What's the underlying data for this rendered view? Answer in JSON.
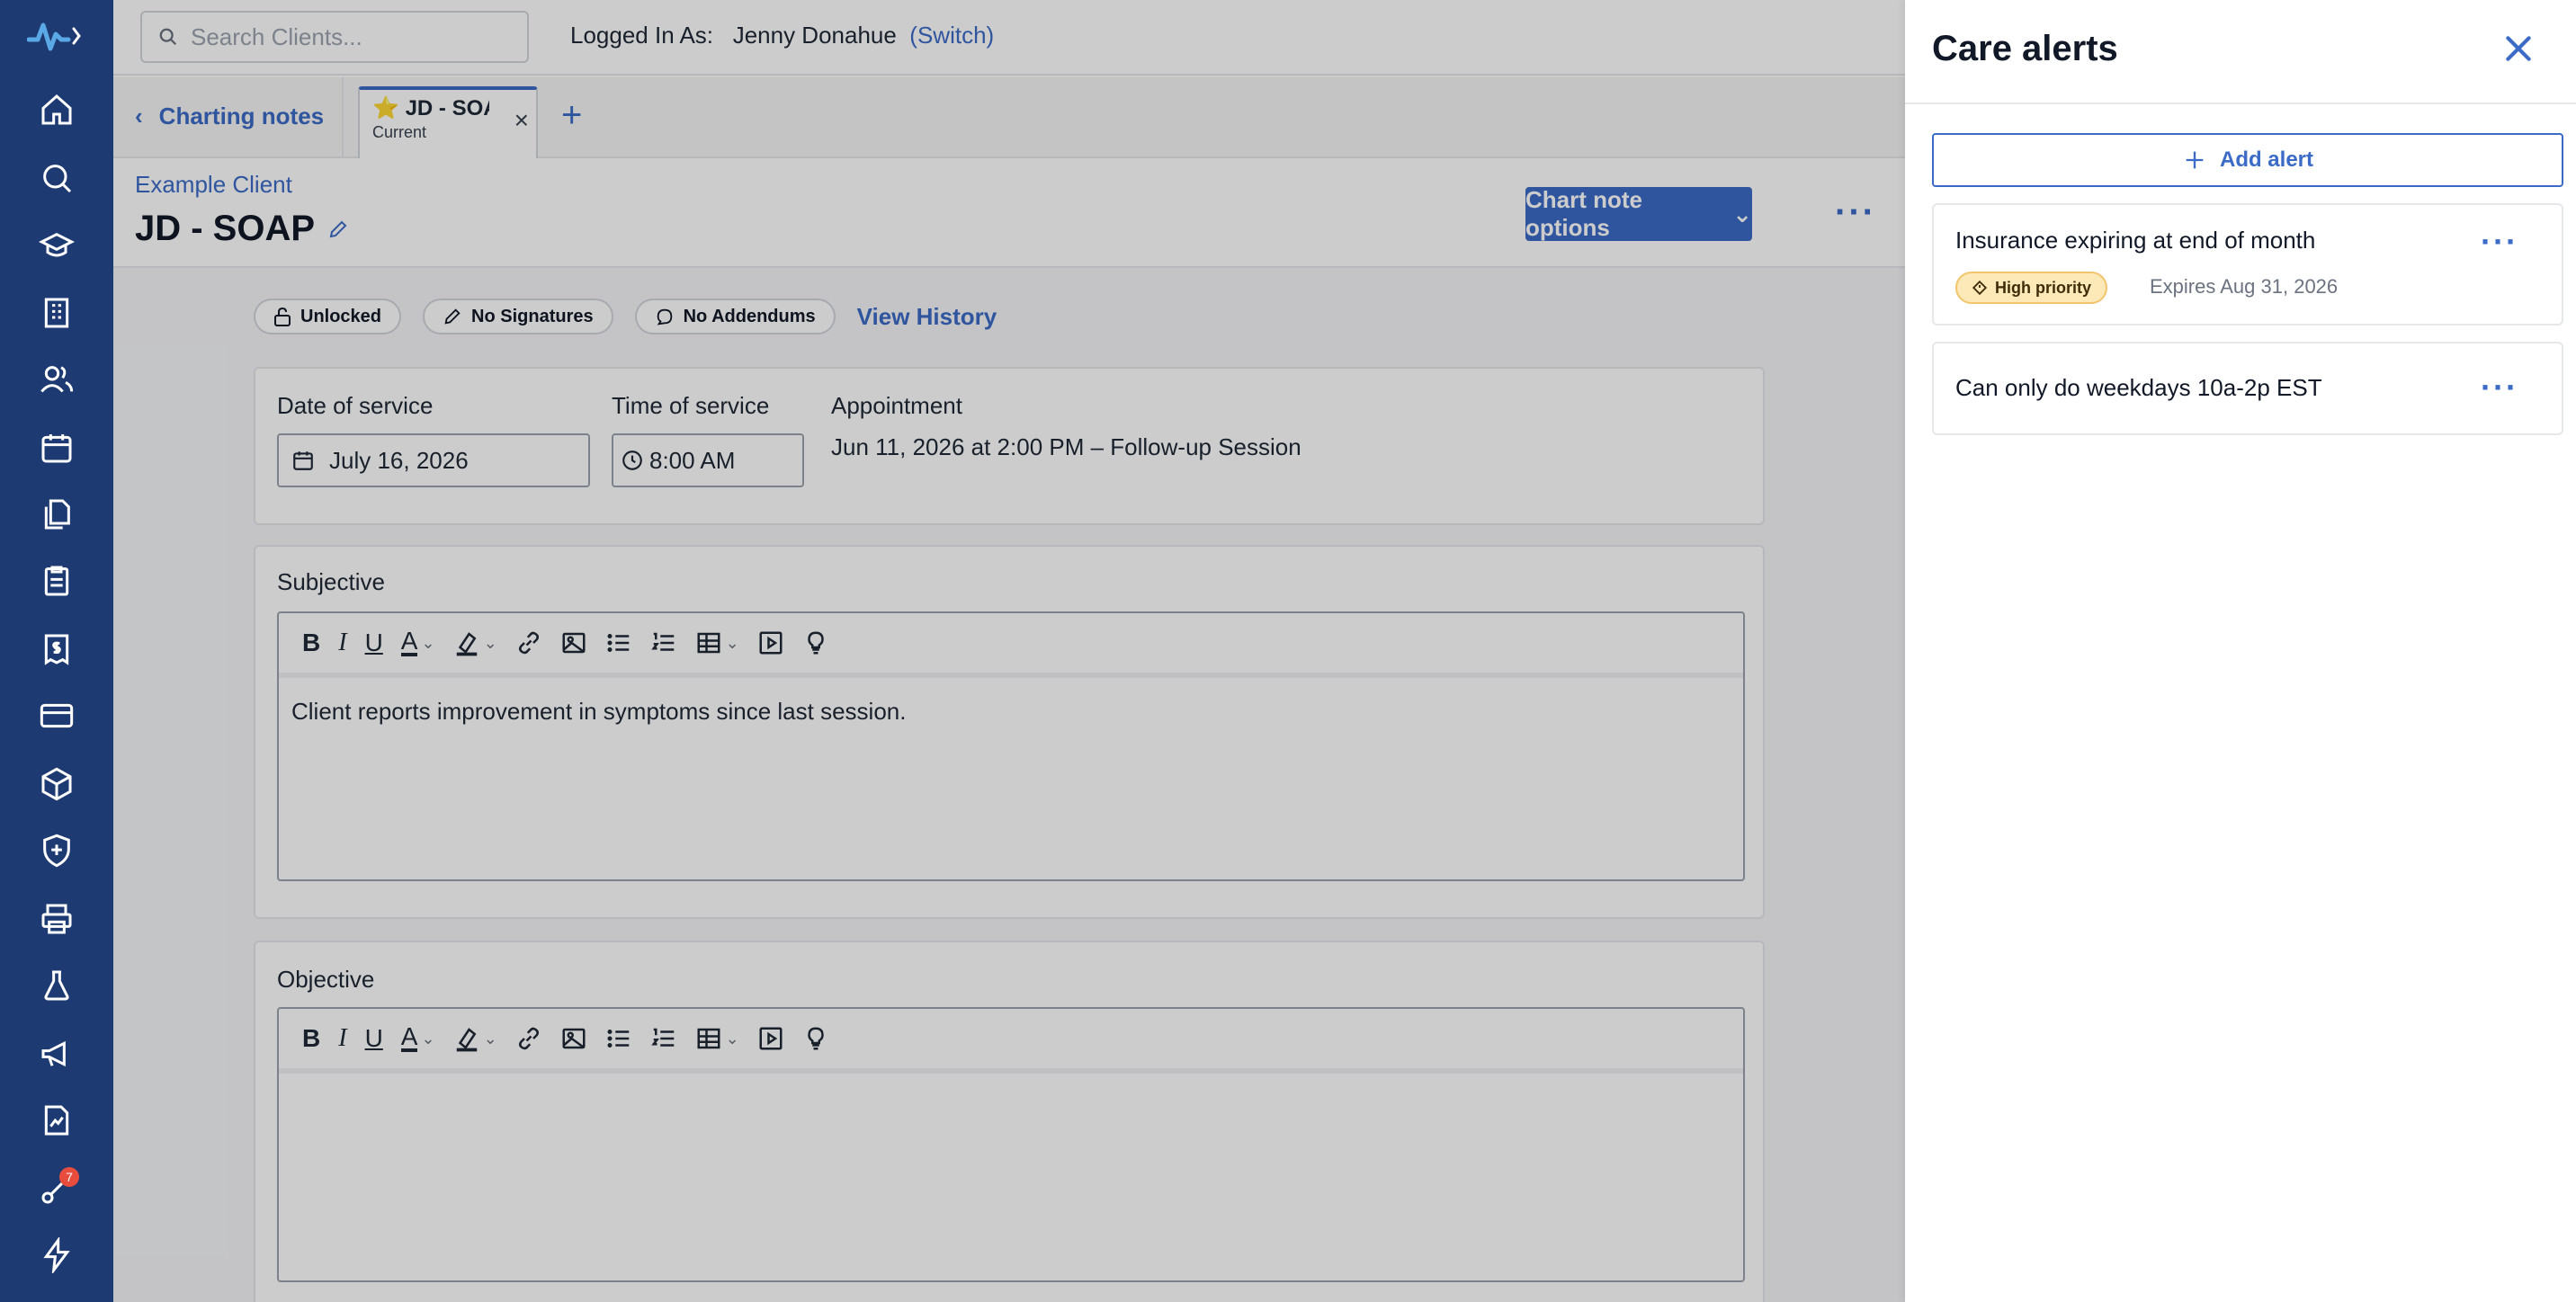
{
  "search": {
    "placeholder": "Search Clients..."
  },
  "session": {
    "logged_in_label": "Logged In As:",
    "user_name": "Jenny Donahue",
    "switch_label": "(Switch)"
  },
  "tabs": {
    "back_label": "Charting notes",
    "current": {
      "title": "JD - SOAP",
      "subtitle": "Current"
    }
  },
  "header": {
    "client_name": "Example Client",
    "note_title": "JD - SOAP",
    "options_label": "Chart note options"
  },
  "status_pills": [
    {
      "label": "Unlocked",
      "icon": "lock-open-icon"
    },
    {
      "label": "No Signatures",
      "icon": "pencil-icon"
    },
    {
      "label": "No Addendums",
      "icon": "comment-icon"
    }
  ],
  "view_history_label": "View History",
  "service": {
    "date_label": "Date of service",
    "date_value": "July 16, 2026",
    "time_label": "Time of service",
    "time_value": "8:00 AM",
    "appointment_label": "Appointment",
    "appointment_value": "Jun 11, 2026 at 2:00 PM – Follow-up Session"
  },
  "sections": {
    "subjective": {
      "label": "Subjective",
      "body": "Client reports improvement in symptoms since last session."
    },
    "objective": {
      "label": "Objective",
      "body": ""
    }
  },
  "nav_badge": "7",
  "panel": {
    "title": "Care alerts",
    "add_label": "Add alert",
    "alerts": [
      {
        "text": "Insurance expiring at end of month",
        "priority": "High priority",
        "expires": "Expires Aug 31, 2026"
      },
      {
        "text": "Can only do weekdays 10a-2p EST"
      }
    ]
  },
  "colors": {
    "rail": "#1d3a72",
    "accent": "#3b6bc7",
    "priority_bg": "#fde9b8"
  }
}
